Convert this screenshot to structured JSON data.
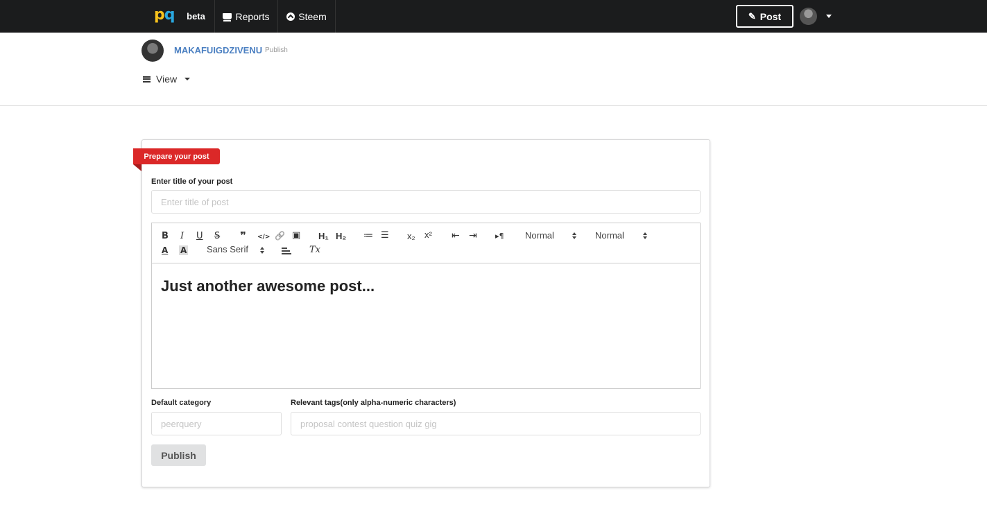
{
  "nav": {
    "logo_p": "p",
    "logo_q": "q",
    "beta": "beta",
    "reports": "Reports",
    "steem": "Steem",
    "post": "Post"
  },
  "user": {
    "name": "MAKAFUIGDZIVENU",
    "sub": "Publish"
  },
  "view_menu": {
    "label": "View"
  },
  "card": {
    "ribbon": "Prepare your post",
    "title_label": "Enter title of your post",
    "title_placeholder": "Enter title of post",
    "editor_text": "Just another awesome post...",
    "category_label": "Default category",
    "category_placeholder": "peerquery",
    "tags_label": "Relevant tags(only alpha-numeric characters)",
    "tags_placeholder": "proposal contest question quiz gig",
    "publish": "Publish"
  },
  "toolbar": {
    "bold": "B",
    "italic": "I",
    "underline": "U",
    "strike": "S",
    "blockquote": "❞",
    "code": "</>",
    "link": "🔗",
    "image": "▣",
    "h1": "H₁",
    "h2": "H₂",
    "ordered_list": "≔",
    "bullet_list": "☰",
    "subscript": "x₂",
    "superscript": "x²",
    "outdent": "⇤",
    "indent": "⇥",
    "direction": "▸¶",
    "size_select": "Normal",
    "header_select": "Normal",
    "color": "A",
    "background": "A",
    "font_select": "Sans Serif",
    "clean": "Tx"
  },
  "colors": {
    "brand_red": "#db2828",
    "nav_bg": "#1b1c1d",
    "link_blue": "#4a7fc1"
  }
}
